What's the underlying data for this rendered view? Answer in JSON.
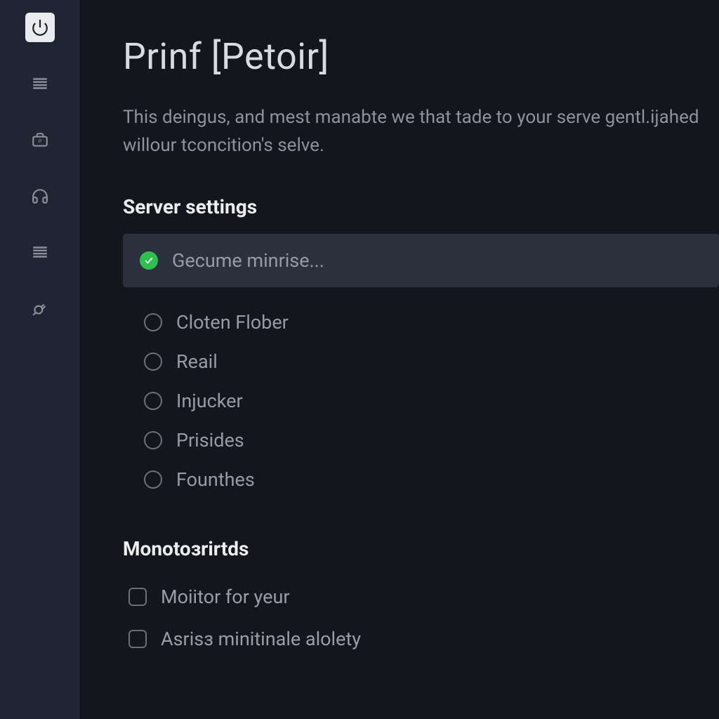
{
  "sidebar": {
    "items": [
      {
        "name": "power-icon",
        "active": true
      },
      {
        "name": "menu-icon",
        "active": false
      },
      {
        "name": "briefcase-icon",
        "active": false
      },
      {
        "name": "headphones-icon",
        "active": false
      },
      {
        "name": "list-icon",
        "active": false
      },
      {
        "name": "plug-icon",
        "active": false
      }
    ]
  },
  "page": {
    "title": "Prinf [Petoir]",
    "description": "This deingus, and mest manabte we that tade to your serve gentl.ijahed willour tconcition's selve."
  },
  "server_settings": {
    "heading": "Server settings",
    "options": [
      {
        "label": "Gecume minrise...",
        "selected": true
      },
      {
        "label": "Cloten Flober",
        "selected": false
      },
      {
        "label": "Reail",
        "selected": false
      },
      {
        "label": "Injucker",
        "selected": false
      },
      {
        "label": "Prisides",
        "selected": false
      },
      {
        "label": "Founthes",
        "selected": false
      }
    ]
  },
  "monitors": {
    "heading": "Monotoзrirtds",
    "options": [
      {
        "label": "Moiitor for yeur",
        "checked": false
      },
      {
        "label": "Asrisз minitinale alolety",
        "checked": false
      }
    ]
  },
  "colors": {
    "accent_green": "#2fbf4f",
    "bg_main": "#13161d",
    "bg_sidebar": "#1f2533",
    "bg_selected_row": "#2a303c"
  }
}
